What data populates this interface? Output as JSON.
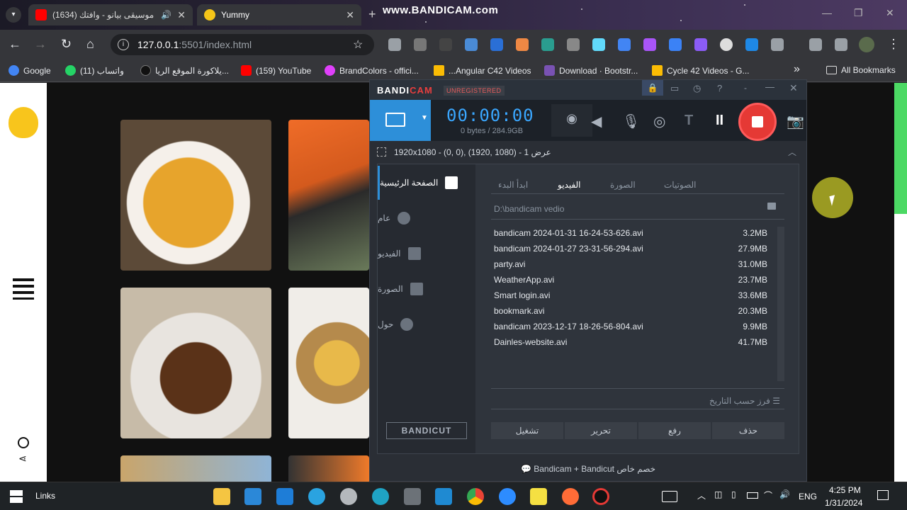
{
  "browser": {
    "tabs": [
      {
        "label": "(1634) موسيقى بيانو - وافتك",
        "active": false
      },
      {
        "label": "Yummy",
        "active": true
      }
    ],
    "watermark": "www.BANDICAM.com",
    "address": {
      "host": "127.0.0.1",
      "path": ":5501/index.html"
    },
    "bookmarks": [
      {
        "label": "Google",
        "color": "#4285f4"
      },
      {
        "label": "(11) واتساب",
        "color": "#25d366"
      },
      {
        "label": "يلاكورة الموقع الريا...",
        "color": "#111111"
      },
      {
        "label": "(159) YouTube",
        "color": "#ff0000"
      },
      {
        "label": "BrandColors - offici...",
        "color": "#e040fb"
      },
      {
        "label": "...Angular C42 Videos",
        "color": "#fbbc04"
      },
      {
        "label": "Download · Bootstr...",
        "color": "#7952b3"
      },
      {
        "label": "Cycle 42 Videos - G...",
        "color": "#fbbc04"
      }
    ],
    "more_bookmarks": "»",
    "all_bookmarks": "All Bookmarks"
  },
  "bandicam": {
    "logo_a": "BANDI",
    "logo_b": "CAM",
    "unregistered": "UNREGISTERED",
    "timer": "00:00:00",
    "size": "0 bytes / 284.9GB",
    "region": "1920x1080 - (0, 0), (1920, 1080) - عرض 1",
    "sidebar": [
      "الصفحة الرئيسية",
      "عام",
      "الفيديو",
      "الصورة",
      "حول"
    ],
    "tabs": [
      "ابدأ البدء",
      "الفيديو",
      "الصورة",
      "الصوتيات"
    ],
    "folder": "D:\\bandicam vedio",
    "files": [
      {
        "name": "bandicam 2024-01-31 16-24-53-626.avi",
        "size": "3.2MB"
      },
      {
        "name": "bandicam 2024-01-27 23-31-56-294.avi",
        "size": "27.9MB"
      },
      {
        "name": "party.avi",
        "size": "31.0MB"
      },
      {
        "name": "WeatherApp.avi",
        "size": "23.7MB"
      },
      {
        "name": "Smart login.avi",
        "size": "33.6MB"
      },
      {
        "name": "bookmark.avi",
        "size": "20.3MB"
      },
      {
        "name": "bandicam 2023-12-17 18-26-56-804.avi",
        "size": "9.9MB"
      },
      {
        "name": "Dainles-website.avi",
        "size": "41.7MB"
      }
    ],
    "sort": "فرز حسب التاريخ",
    "actions": [
      "تشغيل",
      "تحرير",
      "رفع",
      "حذف"
    ],
    "bandicut": "BANDICUT",
    "footer": "Bandicam + Bandicut خصم خاص"
  },
  "taskbar": {
    "links": "Links",
    "lang": "ENG",
    "time": "4:25 PM",
    "date": "1/31/2024"
  }
}
